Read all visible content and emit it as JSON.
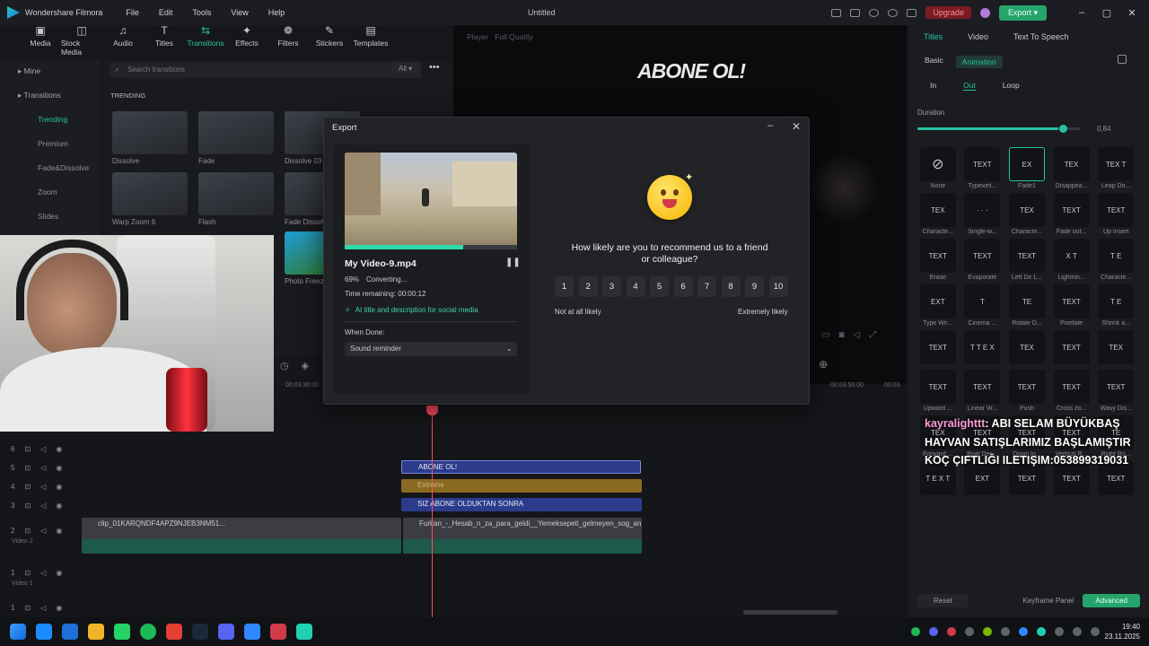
{
  "app": {
    "name": "Wondershare Filmora",
    "window_title": "Untitled"
  },
  "menu": [
    "File",
    "Edit",
    "Tools",
    "View",
    "Help"
  ],
  "header": {
    "upgrade_label": "Upgrade",
    "export_label": "Export"
  },
  "toolbar": [
    {
      "label": "Media",
      "icon": "media-icon",
      "glyph": "▣"
    },
    {
      "label": "Stock Media",
      "icon": "stock-media-icon",
      "glyph": "◫"
    },
    {
      "label": "Audio",
      "icon": "audio-icon",
      "glyph": "♫"
    },
    {
      "label": "Titles",
      "icon": "titles-icon",
      "glyph": "T"
    },
    {
      "label": "Transitions",
      "icon": "transitions-icon",
      "glyph": "⇆",
      "active": true
    },
    {
      "label": "Effects",
      "icon": "effects-icon",
      "glyph": "✦"
    },
    {
      "label": "Filters",
      "icon": "filters-icon",
      "glyph": "❁"
    },
    {
      "label": "Stickers",
      "icon": "stickers-icon",
      "glyph": "✎"
    },
    {
      "label": "Templates",
      "icon": "templates-icon",
      "glyph": "▤"
    }
  ],
  "sidebar": {
    "items": [
      {
        "label": "Mine",
        "type": "head"
      },
      {
        "label": "Transitions",
        "type": "head"
      },
      {
        "label": "Trending",
        "type": "active"
      },
      {
        "label": "Premium"
      },
      {
        "label": "Fade&Dissolve"
      },
      {
        "label": "Zoom"
      },
      {
        "label": "Slides"
      }
    ]
  },
  "library": {
    "search_placeholder": "Search transitions",
    "filter_label": "All",
    "section_label": "TRENDING",
    "items": [
      "Dissolve",
      "Fade",
      "Dissolve 03",
      "Warp Zoom 6",
      "Flash",
      "Fade Dissolv...",
      "Photo Freez..."
    ]
  },
  "player": {
    "tab_label": "Player",
    "quality_label": "Full Quality",
    "overlay_text": "ABONE OL!"
  },
  "right_panel": {
    "tabs": [
      "Titles",
      "Video",
      "Text To Speech"
    ],
    "subtabs": [
      "Basic",
      "Animation"
    ],
    "phase_tabs": [
      "In",
      "Out",
      "Loop"
    ],
    "duration_label": "Duration",
    "duration_value": "0,84",
    "duration_fraction": 0.86,
    "presets": [
      {
        "label": "None",
        "thumb": "⊘"
      },
      {
        "label": "Typewrit...",
        "thumb": "TEXT"
      },
      {
        "label": "Fade1",
        "thumb": "EX",
        "selected": true
      },
      {
        "label": "Disappea...",
        "thumb": "TEX"
      },
      {
        "label": "Leap Do...",
        "thumb": "TEX T"
      },
      {
        "label": "Characte...",
        "thumb": "TEX"
      },
      {
        "label": "Single-w...",
        "thumb": "· · ·"
      },
      {
        "label": "Characte...",
        "thumb": "TEX"
      },
      {
        "label": "Fade out...",
        "thumb": "TEXT"
      },
      {
        "label": "Up Insert",
        "thumb": "TEXT"
      },
      {
        "label": "Erase",
        "thumb": "TEXT"
      },
      {
        "label": "Evaporate",
        "thumb": "TEXT"
      },
      {
        "label": "Left Dir L...",
        "thumb": "TEXT"
      },
      {
        "label": "Lightnin...",
        "thumb": "X T"
      },
      {
        "label": "Characte...",
        "thumb": "T E"
      },
      {
        "label": "Type Wri...",
        "thumb": "EXT"
      },
      {
        "label": "Cinema ...",
        "thumb": "T"
      },
      {
        "label": "Rotate D...",
        "thumb": "TE"
      },
      {
        "label": "Pixelate",
        "thumb": "TEXT"
      },
      {
        "label": "Shrink a...",
        "thumb": "T E"
      },
      {
        "label": "",
        "thumb": "TEXT"
      },
      {
        "label": "",
        "thumb": "T T E X"
      },
      {
        "label": "",
        "thumb": "TEX"
      },
      {
        "label": "",
        "thumb": "TEXT"
      },
      {
        "label": "",
        "thumb": "TEX"
      },
      {
        "label": "Upward ...",
        "thumb": "TEXT"
      },
      {
        "label": "Linear W...",
        "thumb": "TEXT"
      },
      {
        "label": "Push",
        "thumb": "TEXT"
      },
      {
        "label": "Cross zo...",
        "thumb": "TEXT"
      },
      {
        "label": "Wavy Dis...",
        "thumb": "TEXT"
      },
      {
        "label": "Forward ...",
        "thumb": "TEX"
      },
      {
        "label": "Boat Des...",
        "thumb": "TEXT"
      },
      {
        "label": "Down In...",
        "thumb": "TEXT"
      },
      {
        "label": "Vertical R...",
        "thumb": "TEXT"
      },
      {
        "label": "Right Ro...",
        "thumb": "TE"
      },
      {
        "label": "",
        "thumb": "T E X T"
      },
      {
        "label": "",
        "thumb": "EXT"
      },
      {
        "label": "",
        "thumb": "TEXT"
      },
      {
        "label": "",
        "thumb": "TEXT"
      },
      {
        "label": "",
        "thumb": "TEXT"
      }
    ],
    "reset_label": "Reset",
    "keyframe_label": "Keyframe Panel",
    "advanced_label": "Advanced"
  },
  "timeline": {
    "timecodes": [
      "00:03:36:00",
      "00:03:56:00",
      "00:03"
    ],
    "tracks": [
      {
        "num": "6"
      },
      {
        "num": "5"
      },
      {
        "num": "4"
      },
      {
        "num": "3"
      },
      {
        "num": "2",
        "label": "Video 2"
      },
      {
        "num": "1",
        "label": "Video 1"
      },
      {
        "num": "1"
      }
    ],
    "clips": [
      {
        "label": "ABONE OL!",
        "color": "#2c3b8c"
      },
      {
        "label": "Extreme",
        "color": "#8a6a22"
      },
      {
        "label": "SIZ ABONE OLDUKTAN SONRA",
        "color": "#2c3b8c"
      },
      {
        "label": "clip_01KARQNDF4APZ9NJEB3NM51..."
      },
      {
        "label": "Furkan_-_Hesab_n_za_para_geldi__Yemeksepeti_gelmeyen_sog_an_h..."
      }
    ]
  },
  "chat": {
    "user": "kayralighttt",
    "message": ": ABI SELAM BÜYÜKBAŞ HAYVAN SATIŞLARIMIZ BAŞLAMIŞTIR KOÇ ÇIFTLIĞI ILETIŞIM:053899319031"
  },
  "export_dialog": {
    "title": "Export",
    "file_name": "My Video-9.mp4",
    "percent": "69%",
    "progress_fraction": 0.69,
    "status": "Converting...",
    "time_remaining": "Time remaining: 00:00:12",
    "ai_link": "AI title and description for social media",
    "when_done_label": "When Done:",
    "when_done_value": "Sound reminder",
    "question": "How likely are you to recommend us to a friend or colleague?",
    "scores": [
      "1",
      "2",
      "3",
      "4",
      "5",
      "6",
      "7",
      "8",
      "9",
      "10"
    ],
    "low_label": "Not at all likely",
    "high_label": "Extremely likely"
  },
  "taskbar": {
    "apps": [
      "#1a8cff",
      "#1e6fd9",
      "#f0b429",
      "#25d366",
      "#1db954",
      "#e34133",
      "#1b2838",
      "#5865f2",
      "#2f88ff",
      "#d23a4a",
      "#1fd1b1"
    ],
    "time": "19:40",
    "date": "23.11.2025"
  }
}
